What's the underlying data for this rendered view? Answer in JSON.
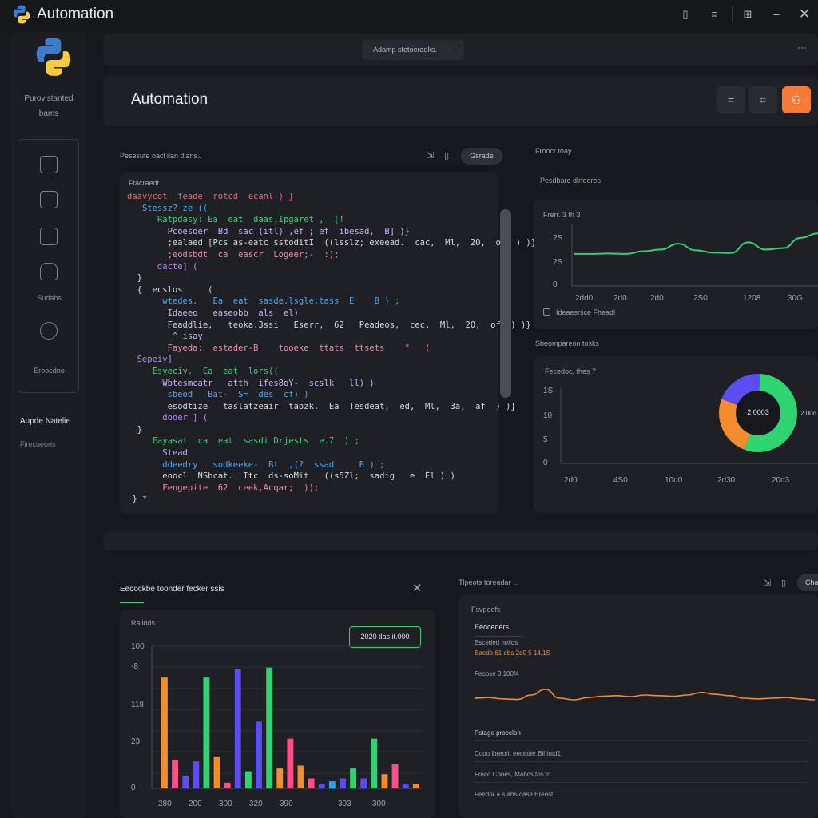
{
  "app": {
    "title": "Automation"
  },
  "window_controls": [
    "mobile",
    "minimize",
    "grid",
    "restore",
    "close"
  ],
  "sidebar": {
    "subtitle_line1": "Purovistanted",
    "subtitle_line2": "bams",
    "nav_label_1": "Sudabs",
    "nav_label_2": "Eroocdno",
    "section_title": "Aupde Natelie",
    "section_sub": "Firecueoris"
  },
  "topbar": {
    "search_label": "Adamp stetoeradks.",
    "more": "···"
  },
  "header": {
    "title": "Automation"
  },
  "editor": {
    "breadcrumb": "Pesesute oacl ilan ttlans..",
    "action_label": "Gsrade",
    "heading": "Ftacraedr",
    "lines": [
      {
        "text": "daavycot  feade  rotcd  ecanl ) }",
        "color": "#e26a6a"
      },
      {
        "text": "   Stessz? ze ((",
        "color": "#4aa8f0"
      },
      {
        "text": "      Ratpdasy: Ea  eat  daas,Ipgaret ,  [!",
        "color": "#3ad07a"
      },
      {
        "text": "        Pcoesoer  Bd  sac (itl) ,ef ; ef  ibesad,  B] )}",
        "color": "#c7b3f2"
      },
      {
        "text": "        ;ealaed [Pcs as-eatc sstoditI  ((lsslz; exeead.  cac,  Ml,  2O,  of  ) )}",
        "color": "#d6d8de"
      },
      {
        "text": "        ;eodsbdt  ca  eascr  Logeer;-  :);",
        "color": "#f08aa6"
      },
      {
        "text": "      dacte] (",
        "color": "#b48cf2"
      },
      {
        "text": "  }",
        "color": "#d6d8de"
      },
      {
        "text": "  {  ecslos     (",
        "color": "#d6d8de"
      },
      {
        "text": "       wtedes.   Ea  eat  sasde.lsgle;tass  E    B ) ;",
        "color": "#4aa8f0"
      },
      {
        "text": "        Idaeeo   easeobb  als  el)",
        "color": "#c7b3f2"
      },
      {
        "text": "        Feaddlie,   teoka.3ssi   Eserr,  62   Peadeos,  cec,  Ml,  2O,  of  ) )}",
        "color": "#d6d8de"
      },
      {
        "text": "         ^ isay",
        "color": "#c7b3f2"
      },
      {
        "text": "        Fayeda:  estader-B    tooeke  ttats  ttsets    °   (",
        "color": "#f08aa6"
      },
      {
        "text": "  Sepeiy]",
        "color": "#b48cf2"
      },
      {
        "text": "     Esyeciy.  Ca  eat  lors((",
        "color": "#3ad07a"
      },
      {
        "text": "       Wbtesmcatr   atth  ifes8oY-  scslk   ll) )",
        "color": "#c7b3f2"
      },
      {
        "text": "        sbeod   Bat-  S=  des  cf) )",
        "color": "#4aa8f0"
      },
      {
        "text": "        esodtize   taslatzeair  taozk.  Ea  Tesdeat,  ed,  Ml,  3a,  af  ) )}",
        "color": "#d6d8de"
      },
      {
        "text": "       dooer ] (",
        "color": "#b48cf2"
      },
      {
        "text": "  }",
        "color": "#d6d8de"
      },
      {
        "text": "     Eayasat  ca  eat  sasdi Drjests  e.7  ) ;",
        "color": "#3ad07a"
      },
      {
        "text": "       Stead",
        "color": "#c7b3f2"
      },
      {
        "text": "       ddeedry   sodkeeke-  Bt  ,(?  ssad     B ) ;",
        "color": "#4aa8f0"
      },
      {
        "text": "       eoocl  NSbcat.  Itc  ds-soMit   ((s5Zl;  sadig   e  El ) )",
        "color": "#d6d8de"
      },
      {
        "text": "       Fengepite  62  ceek,Acqar;  ));",
        "color": "#f08aa6"
      },
      {
        "text": " } *",
        "color": "#d6d8de"
      }
    ]
  },
  "right_top": {
    "label": "Froocr toay",
    "section": "Pesdbare dlrfeores",
    "chart_label": "Frerr.  3 th 3",
    "legend": "Ideaesrsce Fheadl",
    "x_ticks": [
      "2dd0",
      "2d0",
      "2d0",
      "2S0",
      "1208",
      "30G"
    ],
    "y_ticks": [
      "2S",
      "2S",
      "0"
    ]
  },
  "right_mid": {
    "label": "Sbeompareon tosks",
    "chart_label": "Fecedoc, thes 7",
    "donut_center": "2.0003",
    "donut_side": "2.00d",
    "x_ticks": [
      "2d0",
      "4S0",
      "10d0",
      "2d30",
      "20d3"
    ],
    "y_ticks": [
      "1S",
      "10",
      "5",
      "0"
    ]
  },
  "bottom_left": {
    "tab_label": "Eecockbe toonder fecker ssis",
    "chart_label": "Raliods",
    "badge": "2020 tlas it.000",
    "y_ticks": [
      "100",
      "-8",
      "118",
      "23",
      "0"
    ],
    "x_ticks": [
      "280",
      "200",
      "300",
      "320",
      "390",
      "303",
      "300"
    ]
  },
  "bottom_right": {
    "header": "Tlpeots toreadar ...",
    "action_label": "Cha",
    "heading": "Fsvpeofs",
    "title": "Eeoceders",
    "line1": "Bsceded heilos",
    "line2": "Baedo  61 ebs 2d0 5 14,1S",
    "line3": "Feoose  3 100f4",
    "section": "Pstage procelon",
    "item1": "Cooo lbreorit eeceder Bil totd1",
    "item2": "Frecd Cboes,  Mahcs tos td",
    "item3": "Feedor a sIabs-case Ereost"
  },
  "chart_data": [
    {
      "type": "line",
      "title": "",
      "x_ticks": [
        "2dd0",
        "2d0",
        "2d0",
        "2S0",
        "1208",
        "30G"
      ],
      "series": [
        {
          "values": [
            0.72,
            0.72,
            0.73,
            0.72,
            0.78,
            0.82,
            0.95,
            0.8,
            0.75,
            0.74,
            0.98,
            0.82,
            0.85,
            1.08,
            1.18
          ]
        }
      ],
      "ylim": [
        0,
        1.4
      ],
      "color": "#2fd36f"
    },
    {
      "type": "pie",
      "title": "",
      "values": [
        55,
        25,
        20
      ],
      "colors": [
        "#2fd36f",
        "#f28c2d",
        "#5b4df0"
      ],
      "center_label": "2.0003"
    },
    {
      "type": "bar",
      "title": "",
      "ylim": [
        0,
        100
      ],
      "values": [
        78,
        20,
        9,
        19,
        78,
        22,
        4,
        84,
        12,
        47,
        85,
        14,
        35,
        16,
        7,
        3,
        5,
        7,
        14,
        7,
        35,
        10,
        17,
        3,
        3
      ],
      "colors": [
        "#f28c2d",
        "#ff4f86",
        "#5b4df0",
        "#5b4df0",
        "#2fd36f",
        "#f28c2d",
        "#ff4f86",
        "#5b4df0",
        "#2fd36f",
        "#5b4df0",
        "#2fd36f",
        "#f28c2d",
        "#ff4f86",
        "#f28c2d",
        "#ff4f86",
        "#5b4df0",
        "#2da3f0",
        "#5b4df0",
        "#2fd36f",
        "#5b4df0",
        "#2fd36f",
        "#f28c2d",
        "#ff4f86",
        "#5b4df0",
        "#f28c2d"
      ]
    },
    {
      "type": "line",
      "title": "",
      "series": [
        {
          "values": [
            0.5,
            0.52,
            0.48,
            0.46,
            0.6,
            0.78,
            0.5,
            0.45,
            0.52,
            0.56,
            0.58,
            0.55,
            0.6,
            0.58,
            0.56,
            0.6,
            0.68,
            0.62,
            0.58,
            0.5,
            0.48,
            0.5,
            0.52,
            0.48,
            0.45
          ]
        }
      ],
      "color": "#f28c2d"
    }
  ]
}
